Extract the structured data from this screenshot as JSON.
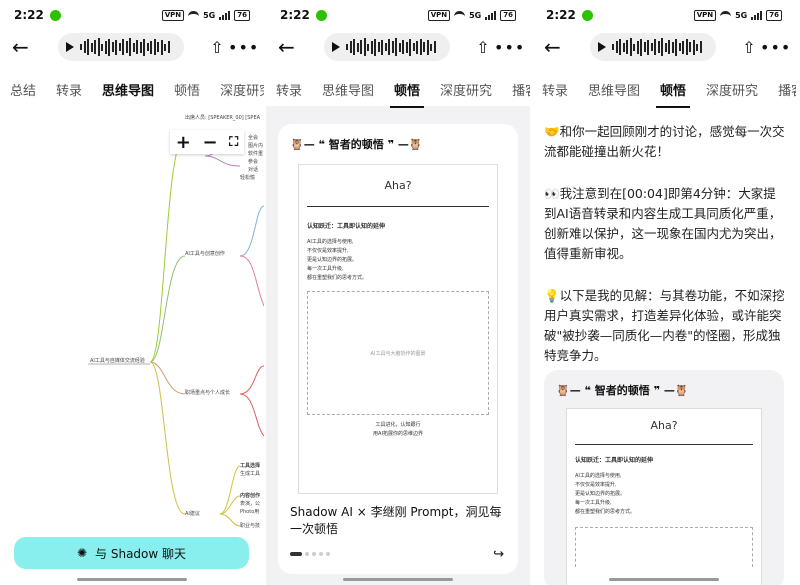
{
  "status": {
    "time": "2:22",
    "vpn": "VPN",
    "net": "5G",
    "battery": "76"
  },
  "nav": {
    "back": "←",
    "share": "⇧",
    "more": "•••"
  },
  "screen1": {
    "tabs": [
      "总结",
      "转录",
      "思维导图",
      "顿悟",
      "深度研究"
    ],
    "active_tab": "思维导图",
    "zoom_in": "+",
    "zoom_out": "−",
    "fit": "⛶",
    "mindmap": {
      "root": "AI工具与自媒体交流经验",
      "top_note": "出席人员: [SPEAKER_00] [SPEA",
      "branch_tool": "AI工具与创意创作",
      "branch_role": "职场重点与个人成长",
      "branch_insight": "AI建议",
      "leaf_1": "全会",
      "leaf_2": "图片内",
      "leaf_3": "软件重",
      "leaf_4": "参会",
      "leaf_5": "对话",
      "leaf_6": "轻松愉",
      "leaf_7": "工具选择",
      "leaf_8": "生成工具",
      "leaf_9": "内容创作",
      "leaf_10": "表演，公",
      "leaf_11": "Photo用",
      "leaf_12": "职业与技"
    },
    "chat_button": "与 Shadow 聊天"
  },
  "screen2": {
    "tabs": [
      "转录",
      "思维导图",
      "顿悟",
      "深度研究",
      "播客"
    ],
    "active_tab": "顿悟",
    "card_title": "🦉— ❝ 智者的顿悟 ❞ —🦉",
    "paper": {
      "aha": "Aha?",
      "heading": "认知跃迁：工具即认知的延伸",
      "lines": [
        "AI工具的选择与使用,",
        "不仅仅是效率提升,",
        "更是认知边界的拓展。",
        "每一次工具升级,",
        "都在重塑我们的思考方式。"
      ],
      "placeholder": "AI工具与大脑协作的图景",
      "foot1": "工具进化，认知跟行",
      "foot2": "用AI拓展你的思维边界"
    },
    "caption": "Shadow AI × 李继刚 Prompt，洞见每一次顿悟"
  },
  "screen3": {
    "tabs": [
      "转录",
      "思维导图",
      "顿悟",
      "深度研究",
      "播客"
    ],
    "active_tab": "顿悟",
    "para1": "🤝和你一起回顾刚才的讨论，感觉每一次交流都能碰撞出新火花！",
    "para2": "👀我注意到在[00:04]即第4分钟：大家提到AI语音转录和内容生成工具同质化严重，创新难以保护，这一现象在国内尤为突出，值得重新审视。",
    "para3": "💡以下是我的见解：与其卷功能，不如深挖用户真实需求，打造差异化体验，或许能突破\"被抄袭—同质化—内卷\"的怪圈，形成独特竞争力。",
    "card_title": "🦉— ❝ 智者的顿悟 ❞ —🦉",
    "paper": {
      "aha": "Aha?",
      "heading": "认知跃迁：工具即认知的延伸",
      "lines": [
        "AI工具的选择与使用,",
        "不仅仅是效率提升,",
        "更是认知边界的拓展。",
        "每一次工具升级,",
        "都在重塑我们的思考方式。"
      ]
    }
  }
}
